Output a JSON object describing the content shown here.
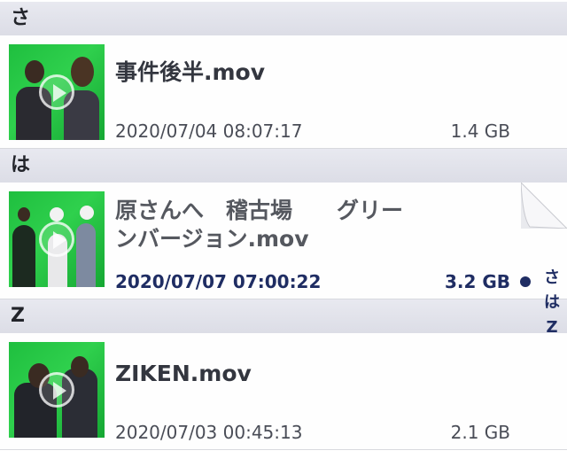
{
  "sections": [
    {
      "header": "さ",
      "items": [
        {
          "title": "事件後半.mov",
          "date": "2020/07/04 08:07:17",
          "size": "1.4 GB"
        }
      ]
    },
    {
      "header": "は",
      "items": [
        {
          "title": "原さんへ　稽古場　　グリーンバージョン.mov",
          "title_line1": "原さんへ　稽古場　　グリー",
          "title_line2": "ンバージョン.mov",
          "date": "2020/07/07 07:00:22",
          "size": "3.2 GB",
          "selected": true
        }
      ]
    },
    {
      "header": "Z",
      "items": [
        {
          "title": "ZIKEN.mov",
          "date": "2020/07/03 00:45:13",
          "size": "2.1 GB"
        }
      ]
    }
  ],
  "index": [
    "さ",
    "は",
    "Z"
  ],
  "colors": {
    "accent": "#1f2d63",
    "green_screen": "#22c443",
    "header_bg": "#e2e3ea"
  }
}
